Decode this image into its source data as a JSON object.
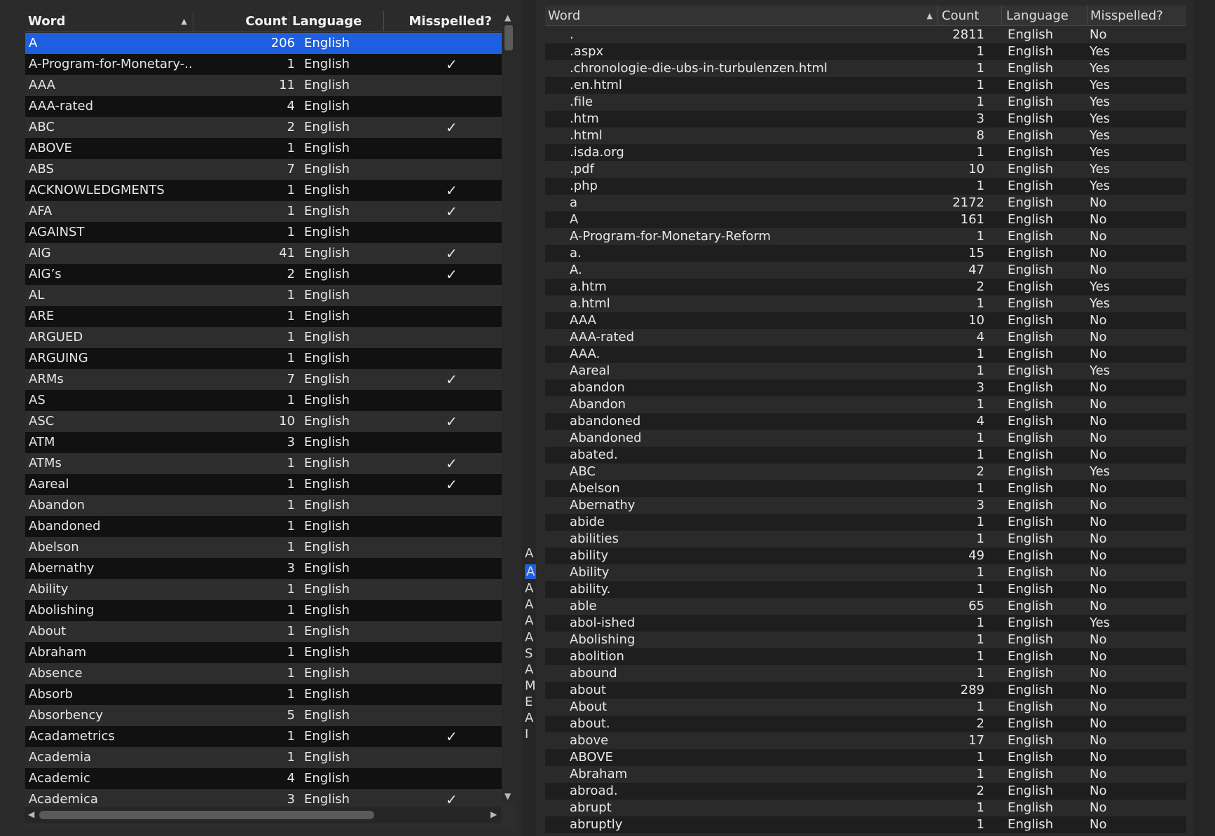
{
  "left_table": {
    "columns": {
      "word": "Word",
      "count": "Count",
      "language": "Language",
      "misspelled": "Misspelled?"
    },
    "check_glyph": "✓",
    "selected_index": 0,
    "rows": [
      {
        "word": "A",
        "count": "206",
        "language": "English",
        "misspelled": false
      },
      {
        "word": "A-Program-for-Monetary-...",
        "count": "1",
        "language": "English",
        "misspelled": true
      },
      {
        "word": "AAA",
        "count": "11",
        "language": "English",
        "misspelled": false
      },
      {
        "word": "AAA-rated",
        "count": "4",
        "language": "English",
        "misspelled": false
      },
      {
        "word": "ABC",
        "count": "2",
        "language": "English",
        "misspelled": true
      },
      {
        "word": "ABOVE",
        "count": "1",
        "language": "English",
        "misspelled": false
      },
      {
        "word": "ABS",
        "count": "7",
        "language": "English",
        "misspelled": false
      },
      {
        "word": "ACKNOWLEDGMENTS",
        "count": "1",
        "language": "English",
        "misspelled": true
      },
      {
        "word": "AFA",
        "count": "1",
        "language": "English",
        "misspelled": true
      },
      {
        "word": "AGAINST",
        "count": "1",
        "language": "English",
        "misspelled": false
      },
      {
        "word": "AIG",
        "count": "41",
        "language": "English",
        "misspelled": true
      },
      {
        "word": "AIG’s",
        "count": "2",
        "language": "English",
        "misspelled": true
      },
      {
        "word": "AL",
        "count": "1",
        "language": "English",
        "misspelled": false
      },
      {
        "word": "ARE",
        "count": "1",
        "language": "English",
        "misspelled": false
      },
      {
        "word": "ARGUED",
        "count": "1",
        "language": "English",
        "misspelled": false
      },
      {
        "word": "ARGUING",
        "count": "1",
        "language": "English",
        "misspelled": false
      },
      {
        "word": "ARMs",
        "count": "7",
        "language": "English",
        "misspelled": true
      },
      {
        "word": "AS",
        "count": "1",
        "language": "English",
        "misspelled": false
      },
      {
        "word": "ASC",
        "count": "10",
        "language": "English",
        "misspelled": true
      },
      {
        "word": "ATM",
        "count": "3",
        "language": "English",
        "misspelled": false
      },
      {
        "word": "ATMs",
        "count": "1",
        "language": "English",
        "misspelled": true
      },
      {
        "word": "Aareal",
        "count": "1",
        "language": "English",
        "misspelled": true
      },
      {
        "word": "Abandon",
        "count": "1",
        "language": "English",
        "misspelled": false
      },
      {
        "word": "Abandoned",
        "count": "1",
        "language": "English",
        "misspelled": false
      },
      {
        "word": "Abelson",
        "count": "1",
        "language": "English",
        "misspelled": false
      },
      {
        "word": "Abernathy",
        "count": "3",
        "language": "English",
        "misspelled": false
      },
      {
        "word": "Ability",
        "count": "1",
        "language": "English",
        "misspelled": false
      },
      {
        "word": "Abolishing",
        "count": "1",
        "language": "English",
        "misspelled": false
      },
      {
        "word": "About",
        "count": "1",
        "language": "English",
        "misspelled": false
      },
      {
        "word": "Abraham",
        "count": "1",
        "language": "English",
        "misspelled": false
      },
      {
        "word": "Absence",
        "count": "1",
        "language": "English",
        "misspelled": false
      },
      {
        "word": "Absorb",
        "count": "1",
        "language": "English",
        "misspelled": false
      },
      {
        "word": "Absorbency",
        "count": "5",
        "language": "English",
        "misspelled": false
      },
      {
        "word": "Acadametrics",
        "count": "1",
        "language": "English",
        "misspelled": true
      },
      {
        "word": "Academia",
        "count": "1",
        "language": "English",
        "misspelled": false
      },
      {
        "word": "Academic",
        "count": "4",
        "language": "English",
        "misspelled": false
      },
      {
        "word": "Academica",
        "count": "3",
        "language": "English",
        "misspelled": true
      }
    ]
  },
  "middle_strip": {
    "letters": [
      "A",
      "A",
      "A",
      "A",
      "A",
      "A",
      "S",
      "A",
      "M",
      "E",
      "A",
      "I"
    ]
  },
  "right_table": {
    "columns": {
      "word": "Word",
      "count": "Count",
      "language": "Language",
      "misspelled": "Misspelled?"
    },
    "rows": [
      {
        "word": ".",
        "count": "2811",
        "language": "English",
        "misspelled": "No"
      },
      {
        "word": ".aspx",
        "count": "1",
        "language": "English",
        "misspelled": "Yes"
      },
      {
        "word": ".chronologie-die-ubs-in-turbulenzen.html",
        "count": "1",
        "language": "English",
        "misspelled": "Yes"
      },
      {
        "word": ".en.html",
        "count": "1",
        "language": "English",
        "misspelled": "Yes"
      },
      {
        "word": ".file",
        "count": "1",
        "language": "English",
        "misspelled": "Yes"
      },
      {
        "word": ".htm",
        "count": "3",
        "language": "English",
        "misspelled": "Yes"
      },
      {
        "word": ".html",
        "count": "8",
        "language": "English",
        "misspelled": "Yes"
      },
      {
        "word": ".isda.org",
        "count": "1",
        "language": "English",
        "misspelled": "Yes"
      },
      {
        "word": ".pdf",
        "count": "10",
        "language": "English",
        "misspelled": "Yes"
      },
      {
        "word": ".php",
        "count": "1",
        "language": "English",
        "misspelled": "Yes"
      },
      {
        "word": "a",
        "count": "2172",
        "language": "English",
        "misspelled": "No"
      },
      {
        "word": "A",
        "count": "161",
        "language": "English",
        "misspelled": "No"
      },
      {
        "word": "A-Program-for-Monetary-Reform",
        "count": "1",
        "language": "English",
        "misspelled": "No"
      },
      {
        "word": "a.",
        "count": "15",
        "language": "English",
        "misspelled": "No"
      },
      {
        "word": "A.",
        "count": "47",
        "language": "English",
        "misspelled": "No"
      },
      {
        "word": "a.htm",
        "count": "2",
        "language": "English",
        "misspelled": "Yes"
      },
      {
        "word": "a.html",
        "count": "1",
        "language": "English",
        "misspelled": "Yes"
      },
      {
        "word": "AAA",
        "count": "10",
        "language": "English",
        "misspelled": "No"
      },
      {
        "word": "AAA-rated",
        "count": "4",
        "language": "English",
        "misspelled": "No"
      },
      {
        "word": "AAA.",
        "count": "1",
        "language": "English",
        "misspelled": "No"
      },
      {
        "word": "Aareal",
        "count": "1",
        "language": "English",
        "misspelled": "Yes"
      },
      {
        "word": "abandon",
        "count": "3",
        "language": "English",
        "misspelled": "No"
      },
      {
        "word": "Abandon",
        "count": "1",
        "language": "English",
        "misspelled": "No"
      },
      {
        "word": "abandoned",
        "count": "4",
        "language": "English",
        "misspelled": "No"
      },
      {
        "word": "Abandoned",
        "count": "1",
        "language": "English",
        "misspelled": "No"
      },
      {
        "word": "abated.",
        "count": "1",
        "language": "English",
        "misspelled": "No"
      },
      {
        "word": "ABC",
        "count": "2",
        "language": "English",
        "misspelled": "Yes"
      },
      {
        "word": "Abelson",
        "count": "1",
        "language": "English",
        "misspelled": "No"
      },
      {
        "word": "Abernathy",
        "count": "3",
        "language": "English",
        "misspelled": "No"
      },
      {
        "word": "abide",
        "count": "1",
        "language": "English",
        "misspelled": "No"
      },
      {
        "word": "abilities",
        "count": "1",
        "language": "English",
        "misspelled": "No"
      },
      {
        "word": "ability",
        "count": "49",
        "language": "English",
        "misspelled": "No"
      },
      {
        "word": "Ability",
        "count": "1",
        "language": "English",
        "misspelled": "No"
      },
      {
        "word": "ability.",
        "count": "1",
        "language": "English",
        "misspelled": "No"
      },
      {
        "word": "able",
        "count": "65",
        "language": "English",
        "misspelled": "No"
      },
      {
        "word": "abol-ished",
        "count": "1",
        "language": "English",
        "misspelled": "Yes"
      },
      {
        "word": "Abolishing",
        "count": "1",
        "language": "English",
        "misspelled": "No"
      },
      {
        "word": "abolition",
        "count": "1",
        "language": "English",
        "misspelled": "No"
      },
      {
        "word": "abound",
        "count": "1",
        "language": "English",
        "misspelled": "No"
      },
      {
        "word": "about",
        "count": "289",
        "language": "English",
        "misspelled": "No"
      },
      {
        "word": "About",
        "count": "1",
        "language": "English",
        "misspelled": "No"
      },
      {
        "word": "about.",
        "count": "2",
        "language": "English",
        "misspelled": "No"
      },
      {
        "word": "above",
        "count": "17",
        "language": "English",
        "misspelled": "No"
      },
      {
        "word": "ABOVE",
        "count": "1",
        "language": "English",
        "misspelled": "No"
      },
      {
        "word": "Abraham",
        "count": "1",
        "language": "English",
        "misspelled": "No"
      },
      {
        "word": "abroad.",
        "count": "2",
        "language": "English",
        "misspelled": "No"
      },
      {
        "word": "abrupt",
        "count": "1",
        "language": "English",
        "misspelled": "No"
      },
      {
        "word": "abruptly",
        "count": "1",
        "language": "English",
        "misspelled": "No"
      }
    ]
  },
  "colors": {
    "selection": "#1d5fe0",
    "row_dark": "#111111",
    "row_light": "#2d2d2d"
  },
  "icons": [
    "sort-ascending-icon",
    "scroll-up-arrow-icon",
    "scroll-down-arrow-icon",
    "scroll-left-arrow-icon",
    "scroll-right-arrow-icon"
  ]
}
